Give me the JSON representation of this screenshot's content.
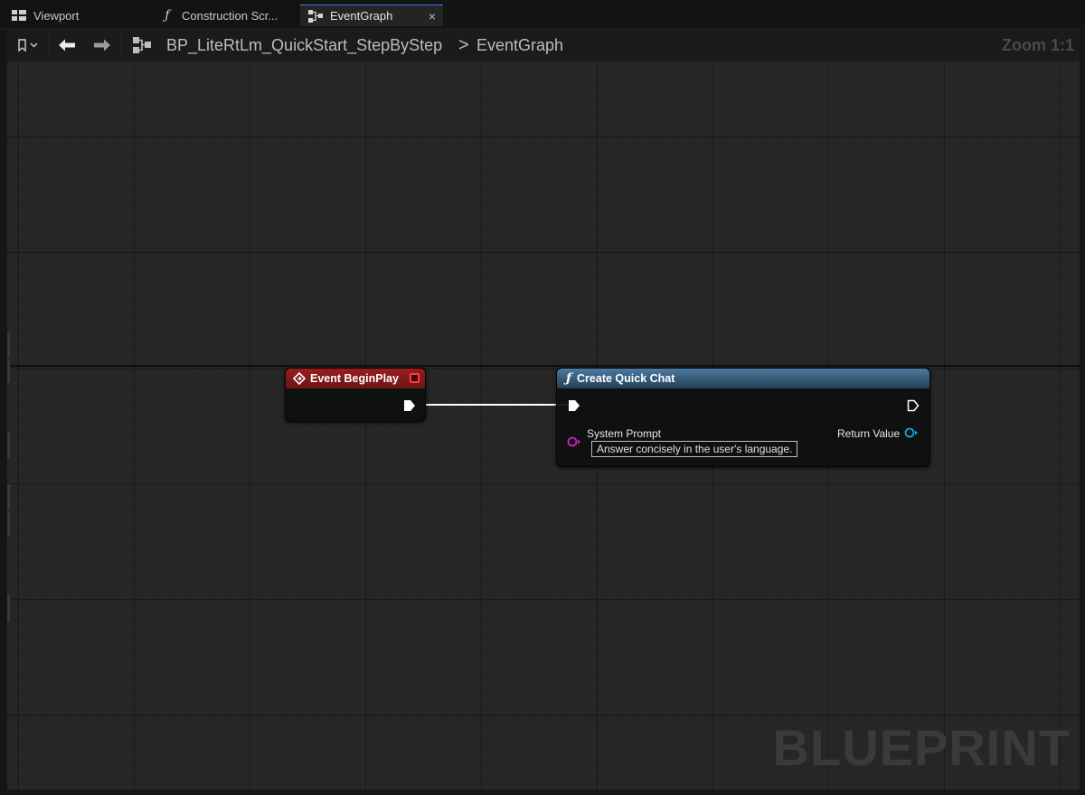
{
  "tabs": [
    {
      "label": "Viewport",
      "icon": "viewport-icon"
    },
    {
      "label": "Construction Scr...",
      "icon": "function-icon"
    },
    {
      "label": "EventGraph",
      "icon": "graph-icon",
      "active": true,
      "close": "×"
    }
  ],
  "toolbar": {
    "breadcrumb_blueprint": "BP_LiteRtLm_QuickStart_StepByStep",
    "breadcrumb_separator": ">",
    "breadcrumb_graph": "EventGraph",
    "zoom": "Zoom 1:1"
  },
  "nodes": {
    "event_begin_play": {
      "title": "Event BeginPlay",
      "header_color": "#8b1c1c"
    },
    "create_quick_chat": {
      "title": "Create Quick Chat",
      "header_color": "#3d6b8f",
      "input_label": "System Prompt",
      "input_value": "Answer concisely in the user's language.",
      "output_label": "Return Value"
    }
  },
  "colors": {
    "string_pin": "#d020c8",
    "object_pin": "#1aa0e0",
    "exec_wire": "#ffffff",
    "tab_active_accent": "#3b7ff0"
  },
  "watermark": "BLUEPRINT"
}
